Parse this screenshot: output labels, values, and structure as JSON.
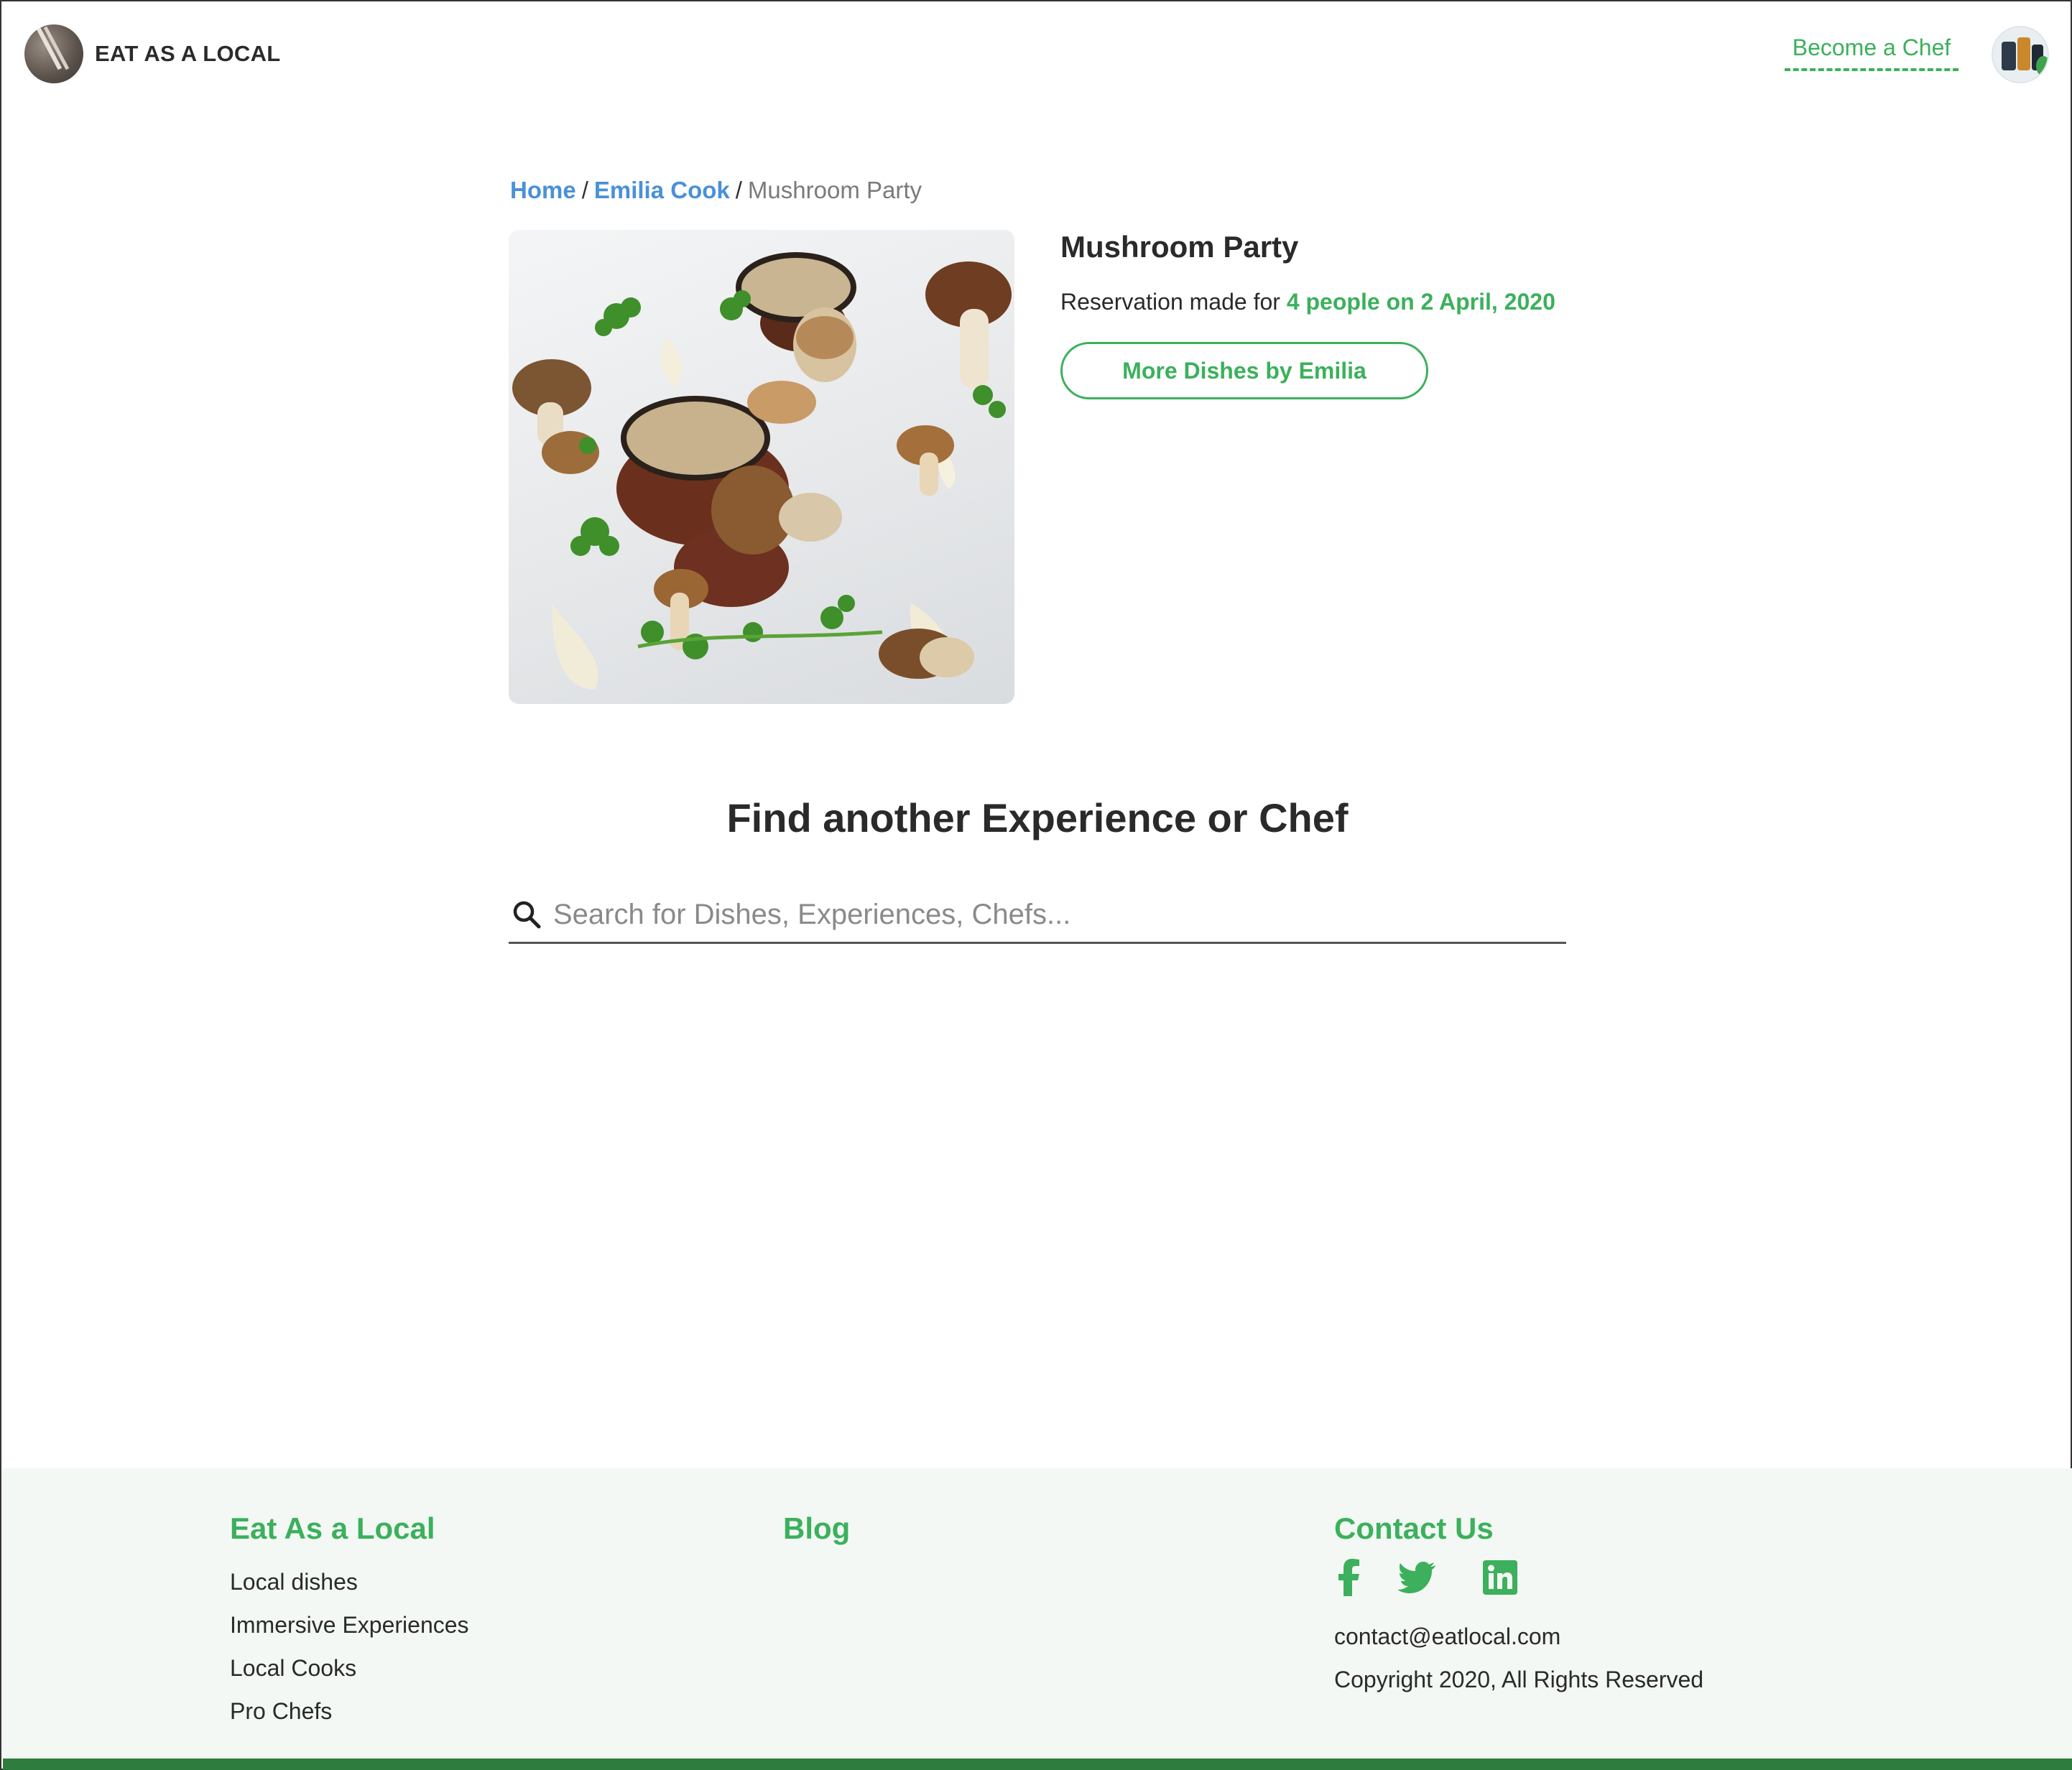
{
  "colors": {
    "accent": "#3cb05c",
    "link": "#4a90d9",
    "footer_bg": "#f3f8f4",
    "footer_bar": "#2f7d3e"
  },
  "header": {
    "logo_text": "EAT AS A LOCAL",
    "become_chef": "Become a Chef"
  },
  "breadcrumb": {
    "home": "Home",
    "sep1": "/",
    "chef": "Emilia Cook",
    "sep2": "/",
    "current": "Mushroom Party"
  },
  "dish": {
    "title": "Mushroom Party",
    "reservation_prefix": "Reservation made for",
    "reservation_detail": "4 people on 2 April, 2020",
    "more_button": "More Dishes by Emilia"
  },
  "search": {
    "title": "Find another Experience or Chef",
    "placeholder": "Search for Dishes, Experiences, Chefs...",
    "icon": "search-icon"
  },
  "footer": {
    "col1": {
      "heading": "Eat As a Local",
      "links": [
        "Local dishes",
        "Immersive Experiences",
        "Local Cooks",
        "Pro Chefs"
      ]
    },
    "col2": {
      "heading": "Blog"
    },
    "col3": {
      "heading": "Contact Us",
      "social_icons": [
        "facebook-icon",
        "twitter-icon",
        "linkedin-icon"
      ],
      "email": "contact@eatlocal.com",
      "copyright": "Copyright 2020, All Rights Reserved"
    }
  }
}
